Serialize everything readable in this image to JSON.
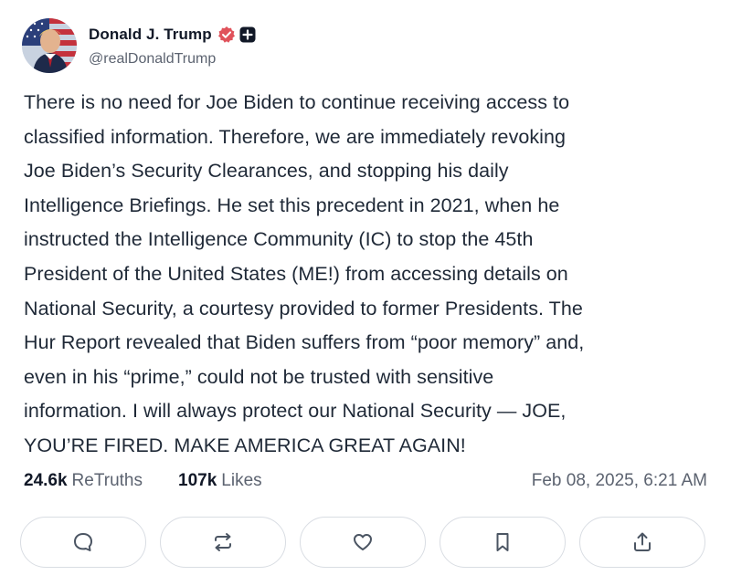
{
  "author": {
    "display_name": "Donald J. Trump",
    "handle": "@realDonaldTrump",
    "avatar_icon": "profile-photo-icon",
    "verified_icon": "verified-badge-icon",
    "verified_color": "#e0525b",
    "plus_icon": "plus-badge-icon"
  },
  "post": {
    "lines": [
      "There is no need for Joe Biden to continue receiving access to",
      "classified information. Therefore, we are immediately revoking",
      "Joe Biden’s Security Clearances, and stopping his daily",
      "Intelligence Briefings. He set this precedent in 2021, when he",
      "instructed the Intelligence Community (IC) to stop the 45th",
      "President of the United States (ME!) from accessing details on",
      "National Security, a courtesy provided to former Presidents. The",
      "Hur Report revealed that Biden suffers from “poor memory” and,",
      "even in his “prime,” could not be trusted with sensitive",
      "information. I will always protect our National Security — JOE,",
      "YOU’RE FIRED. MAKE AMERICA GREAT AGAIN!"
    ]
  },
  "stats": {
    "retruths_count": "24.6k",
    "retruths_label": "ReTruths",
    "likes_count": "107k",
    "likes_label": "Likes",
    "timestamp": "Feb 08, 2025, 6:21 AM"
  },
  "actions": [
    {
      "name": "reply-button",
      "icon": "comment-icon"
    },
    {
      "name": "retruth-button",
      "icon": "repost-icon"
    },
    {
      "name": "like-button",
      "icon": "heart-icon"
    },
    {
      "name": "bookmark-button",
      "icon": "bookmark-icon"
    },
    {
      "name": "share-button",
      "icon": "share-icon"
    }
  ]
}
